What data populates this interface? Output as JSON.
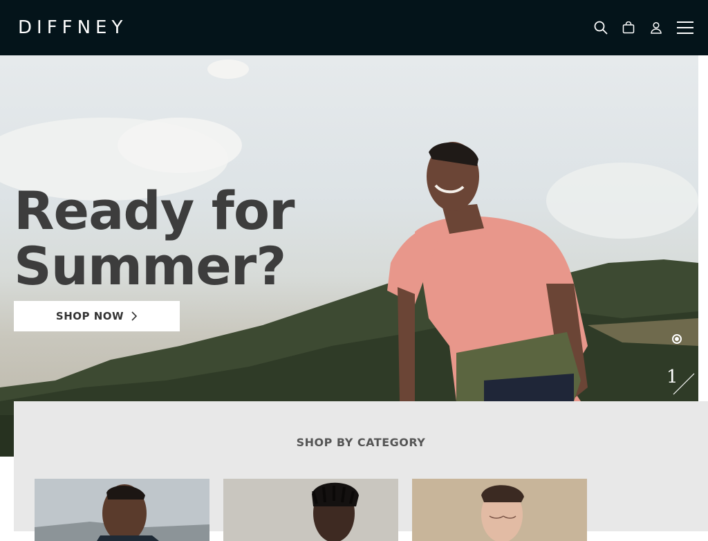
{
  "header": {
    "logo": "DIFFNEY",
    "icons": [
      "search-icon",
      "bag-icon",
      "user-icon",
      "menu-icon"
    ]
  },
  "hero": {
    "title": "Ready for Summer?",
    "cta_label": "SHOP NOW",
    "slide_number": "1"
  },
  "category": {
    "title": "SHOP BY CATEGORY"
  },
  "colors": {
    "header_bg": "#04141a",
    "title_text": "#3d3d3d",
    "section_bg": "#e8e8e8"
  }
}
